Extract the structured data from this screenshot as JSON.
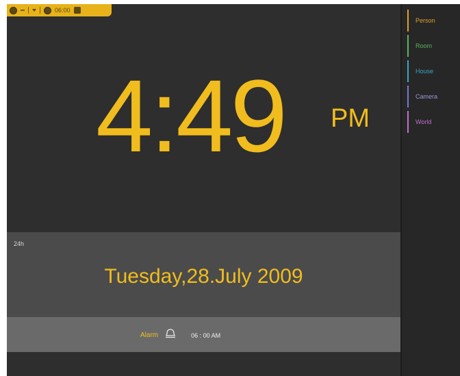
{
  "toolbar": {
    "time": "06:00"
  },
  "clock": {
    "time": "4:49",
    "ampm": "PM"
  },
  "date": {
    "format_label": "24h",
    "text": "Tuesday,28.July 2009"
  },
  "alarm": {
    "label": "Alarm",
    "time": "06 : 00 AM"
  },
  "sidebar": {
    "items": [
      {
        "label": "Person",
        "color": "#e0a030"
      },
      {
        "label": "Room",
        "color": "#5fb35f"
      },
      {
        "label": "House",
        "color": "#3aa6c8"
      },
      {
        "label": "Camera",
        "color": "#7a78d0"
      },
      {
        "label": "World",
        "color": "#c070d0"
      }
    ]
  },
  "colors": {
    "accent": "#f1bd1e",
    "background": "#2e2e2e"
  }
}
